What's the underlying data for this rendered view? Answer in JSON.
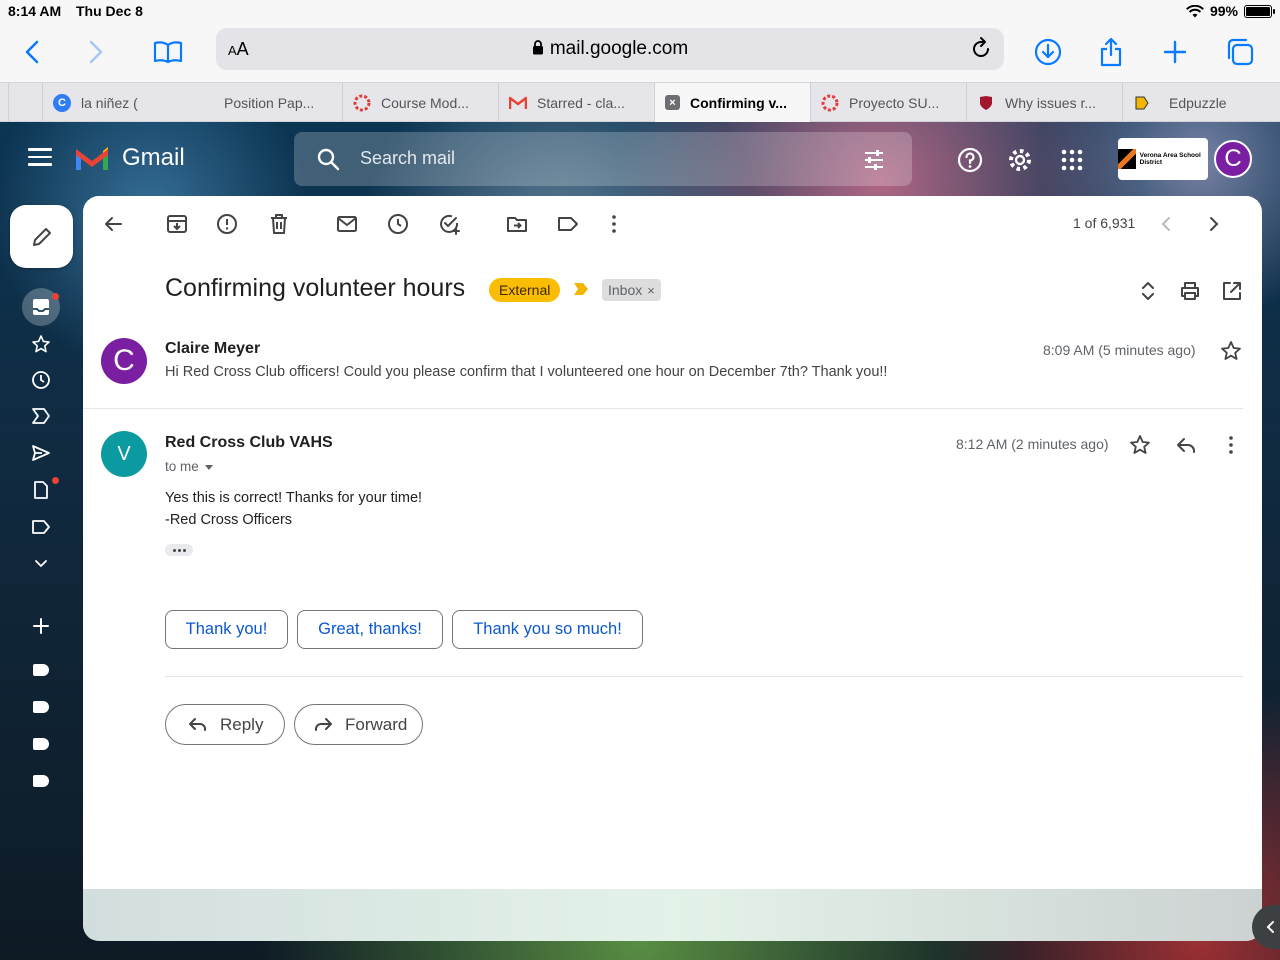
{
  "status_bar": {
    "time": "8:14 AM",
    "date": "Thu Dec 8",
    "battery": "99%",
    "battery_level": 0.99
  },
  "browser": {
    "text_size_label": "AA",
    "url": "mail.google.com",
    "tabs": [
      {
        "label": "la niñez (",
        "favicon": "circle-c-icon",
        "active": false
      },
      {
        "label": "Position Pap...",
        "favicon": "canvas-icon",
        "active": false
      },
      {
        "label": "Course Mod...",
        "favicon": "canvas-icon",
        "active": false
      },
      {
        "label": "Starred - cla...",
        "favicon": "gmail-icon",
        "active": false
      },
      {
        "label": "Confirming v...",
        "favicon": "close-tab-icon",
        "active": true
      },
      {
        "label": "Proyecto SU...",
        "favicon": "canvas-icon",
        "active": false
      },
      {
        "label": "Why issues r...",
        "favicon": "shield-icon",
        "active": false
      },
      {
        "label": "Edpuzzle",
        "favicon": "edpuzzle-icon",
        "active": false
      }
    ]
  },
  "gmail": {
    "app_name": "Gmail",
    "search_placeholder": "Search mail",
    "account_initial": "C",
    "org_logo_text": "Verona Area School District",
    "pager": "1 of 6,931",
    "subject": "Confirming volunteer hours",
    "labels": {
      "external": "External",
      "inbox": "Inbox",
      "inbox_remove": "×"
    },
    "messages": [
      {
        "initial": "C",
        "avatar_color": "#7b1fa2",
        "sender": "Claire Meyer",
        "snippet": "Hi Red Cross Club officers! Could you please confirm that I volunteered one hour on December 7th? Thank you!!",
        "time": "8:09 AM (5 minutes ago)"
      },
      {
        "initial": "V",
        "avatar_color": "#0b9aa0",
        "sender": "Red Cross Club VAHS",
        "to": "to me",
        "time": "8:12 AM (2 minutes ago)",
        "body": [
          "Yes this is correct! Thanks for your time!",
          "-Red Cross Officers"
        ]
      }
    ],
    "smart_replies": [
      "Thank you!",
      "Great, thanks!",
      "Thank you so much!"
    ],
    "actions": {
      "reply": "Reply",
      "forward": "Forward"
    }
  },
  "colors": {
    "accent_blue": "#0a7aff",
    "external_badge": "#fbbc04",
    "smart_reply_text": "#0b57d0"
  }
}
